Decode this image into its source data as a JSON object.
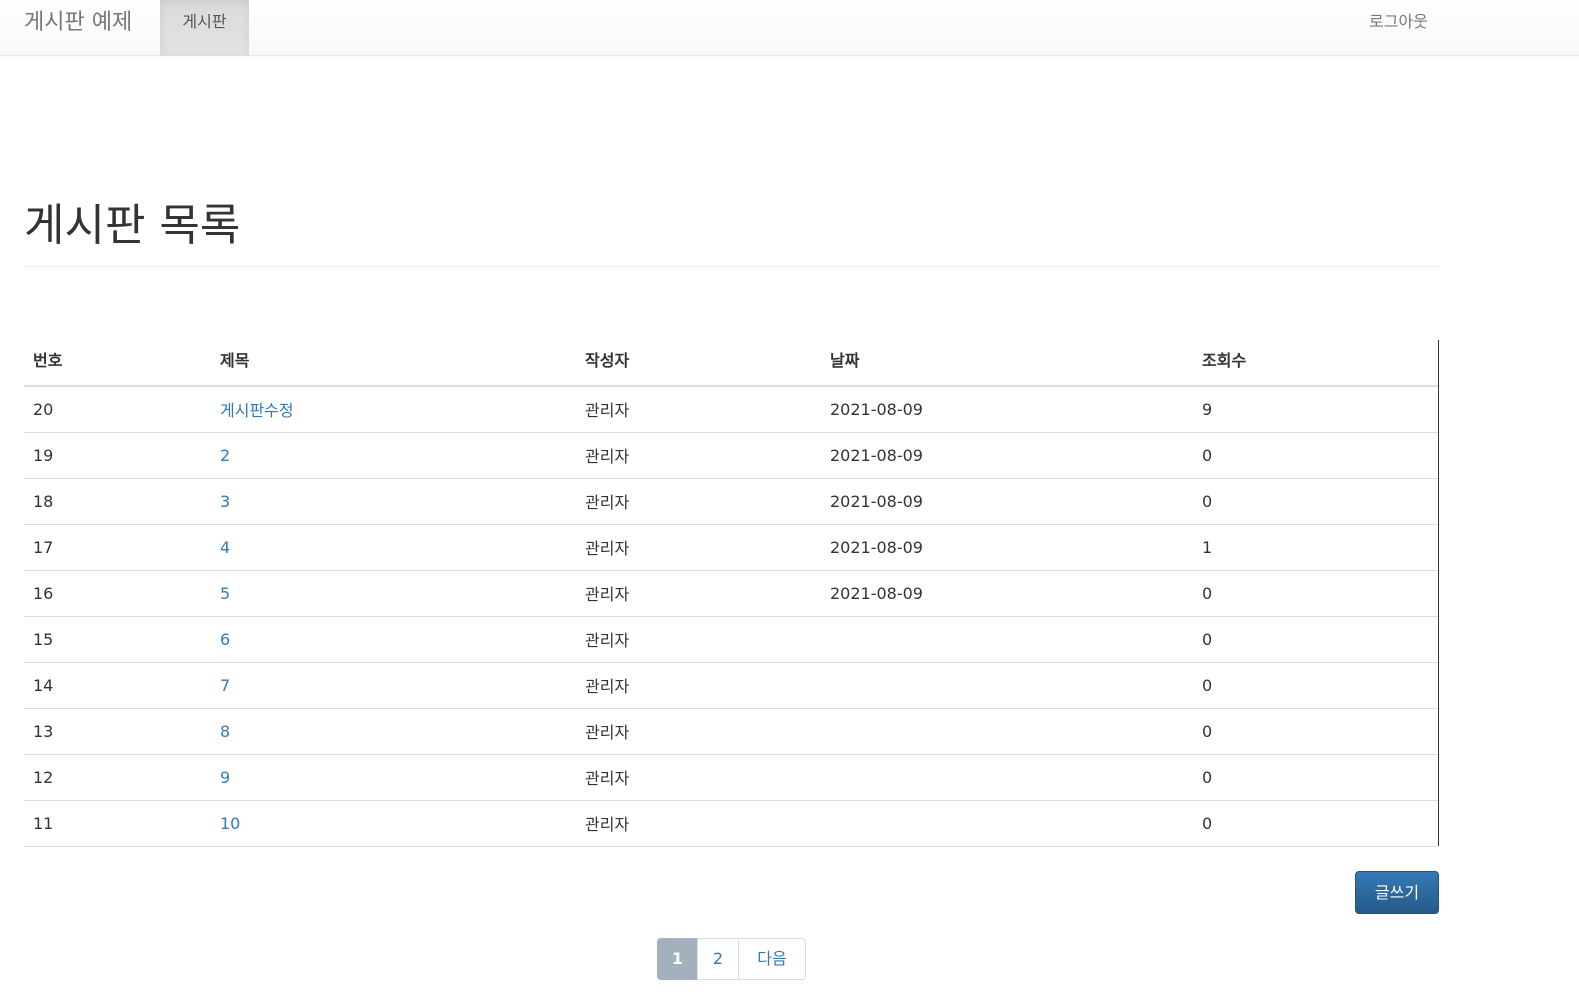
{
  "navbar": {
    "brand": "게시판 예제",
    "active_item": "게시판",
    "logout": "로그아웃"
  },
  "page": {
    "title": "게시판 목록"
  },
  "table": {
    "headers": [
      "번호",
      "제목",
      "작성자",
      "날짜",
      "조회수"
    ],
    "rows": [
      {
        "no": "20",
        "title": "게시판수정",
        "author": "관리자",
        "date": "2021-08-09",
        "views": "9"
      },
      {
        "no": "19",
        "title": "2",
        "author": "관리자",
        "date": "2021-08-09",
        "views": "0"
      },
      {
        "no": "18",
        "title": "3",
        "author": "관리자",
        "date": "2021-08-09",
        "views": "0"
      },
      {
        "no": "17",
        "title": "4",
        "author": "관리자",
        "date": "2021-08-09",
        "views": "1"
      },
      {
        "no": "16",
        "title": "5",
        "author": "관리자",
        "date": "2021-08-09",
        "views": "0"
      },
      {
        "no": "15",
        "title": "6",
        "author": "관리자",
        "date": "",
        "views": "0"
      },
      {
        "no": "14",
        "title": "7",
        "author": "관리자",
        "date": "",
        "views": "0"
      },
      {
        "no": "13",
        "title": "8",
        "author": "관리자",
        "date": "",
        "views": "0"
      },
      {
        "no": "12",
        "title": "9",
        "author": "관리자",
        "date": "",
        "views": "0"
      },
      {
        "no": "11",
        "title": "10",
        "author": "관리자",
        "date": "",
        "views": "0"
      }
    ]
  },
  "write_button": "글쓰기",
  "pagination": {
    "items": [
      "1",
      "2",
      "다음"
    ],
    "active": "1"
  },
  "colors": {
    "link": "#337ab7",
    "primary_button": "#337ab7",
    "active_page": "#a4b0be"
  }
}
